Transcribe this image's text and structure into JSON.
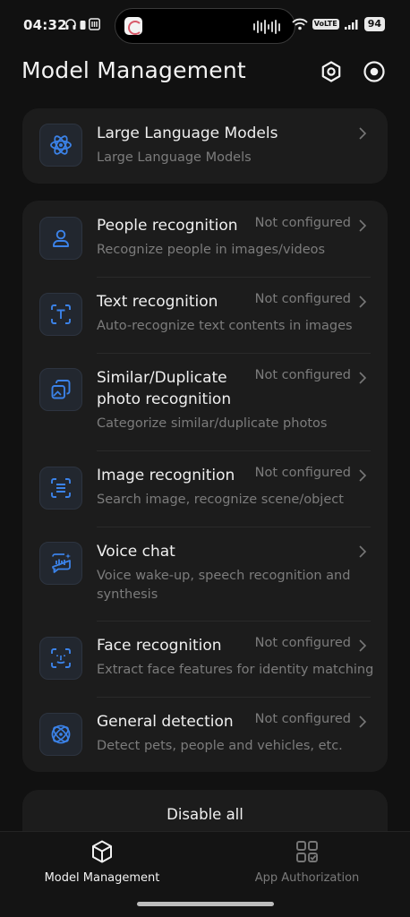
{
  "status_bar": {
    "time": "04:32",
    "volte": "VoLTE",
    "battery": "94",
    "left_icons": [
      "headphones-icon",
      "lock-icon",
      "sim-icon"
    ],
    "right_icons": [
      "wifi-icon",
      "signal-icon"
    ]
  },
  "header": {
    "title": "Model Management",
    "buttons": [
      "settings-icon",
      "record-icon"
    ]
  },
  "llm_card": {
    "title": "Large Language Models",
    "description": "Large Language Models",
    "icon": "atom-icon"
  },
  "features": [
    {
      "title": "People recognition",
      "status": "Not configured",
      "description": "Recognize people in images/videos",
      "icon": "person-icon"
    },
    {
      "title": "Text recognition",
      "status": "Not configured",
      "description": "Auto-recognize text contents in images",
      "icon": "text-scan-icon"
    },
    {
      "title": "Similar/Duplicate photo recognition",
      "status": "Not configured",
      "description": "Categorize similar/duplicate photos",
      "icon": "duplicate-photos-icon"
    },
    {
      "title": "Image recognition",
      "status": "Not configured",
      "description": "Search image, recognize scene/object",
      "icon": "image-scan-icon"
    },
    {
      "title": "Voice chat",
      "status": "",
      "description": "Voice wake-up, speech recognition and synthesis",
      "icon": "voice-chat-icon"
    },
    {
      "title": "Face recognition",
      "status": "Not configured",
      "description": "Extract face features for identity matching",
      "icon": "face-scan-icon"
    },
    {
      "title": "General detection",
      "status": "Not configured",
      "description": "Detect pets, people and vehicles, etc.",
      "icon": "detection-icon"
    }
  ],
  "disable_all": {
    "label": "Disable all"
  },
  "bottom_nav": {
    "items": [
      {
        "label": "Model Management",
        "icon": "cube-icon",
        "active": true
      },
      {
        "label": "App Authorization",
        "icon": "apps-check-icon",
        "active": false
      }
    ]
  },
  "colors": {
    "background": "#111111",
    "card": "#1c1c1c",
    "accent_blue": "#3b82e8",
    "text_primary": "#efefef",
    "text_secondary": "#7c7c7c"
  }
}
